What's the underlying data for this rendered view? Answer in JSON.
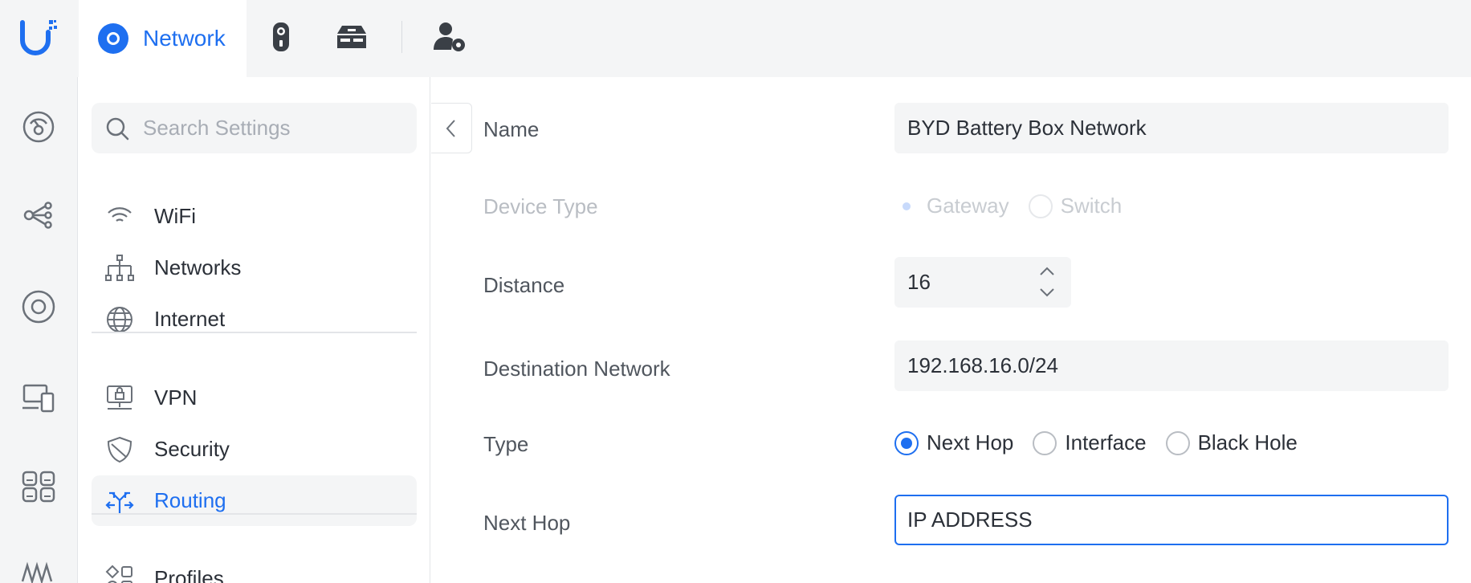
{
  "topbar": {
    "logo_icon": "ubiquiti-logo-icon",
    "active_app": {
      "label": "Network",
      "icon": "network-app-icon"
    },
    "apps": [
      {
        "icon": "camera-app-icon"
      },
      {
        "icon": "access-app-icon"
      },
      {
        "icon": "user-settings-icon"
      }
    ]
  },
  "rail": {
    "icons": [
      "dashboard-icon",
      "topology-icon",
      "devices-icon",
      "clients-icon",
      "ports-icon",
      "statistics-icon"
    ]
  },
  "nav": {
    "search_placeholder": "Search Settings",
    "items": [
      {
        "label": "WiFi",
        "icon": "wifi-icon"
      },
      {
        "label": "Networks",
        "icon": "networks-icon"
      },
      {
        "label": "Internet",
        "icon": "globe-icon"
      },
      {
        "label": "VPN",
        "icon": "vpn-icon"
      },
      {
        "label": "Security",
        "icon": "shield-icon"
      },
      {
        "label": "Routing",
        "icon": "routing-icon"
      },
      {
        "label": "Profiles",
        "icon": "profiles-icon"
      }
    ],
    "active": "Routing"
  },
  "form": {
    "name": {
      "label": "Name",
      "value": "BYD Battery Box Network"
    },
    "device_type": {
      "label": "Device Type",
      "options": [
        "Gateway",
        "Switch"
      ],
      "selected": "Gateway",
      "disabled": true
    },
    "distance": {
      "label": "Distance",
      "value": "16"
    },
    "destination": {
      "label": "Destination Network",
      "value": "192.168.16.0/24"
    },
    "type": {
      "label": "Type",
      "options": [
        "Next Hop",
        "Interface",
        "Black Hole"
      ],
      "selected": "Next Hop"
    },
    "next_hop": {
      "label": "Next Hop",
      "value": "IP ADDRESS"
    }
  },
  "colors": {
    "accent": "#1e6ff0",
    "panel": "#f4f5f6",
    "text": "#2b3038",
    "muted": "#50565e"
  }
}
